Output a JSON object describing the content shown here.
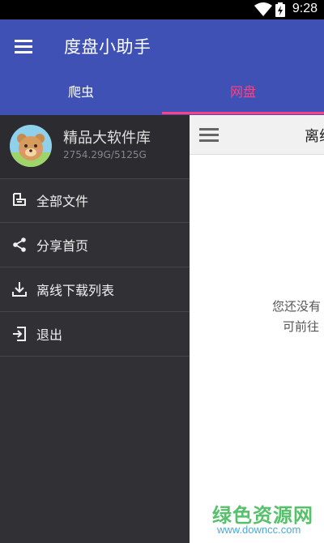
{
  "status_bar": {
    "time": "9:28",
    "icons": [
      "wifi-icon",
      "battery-charging-icon"
    ]
  },
  "app_bar": {
    "title": "度盘小助手",
    "menu_icon": "hamburger-menu-icon",
    "color": "#3f51b5"
  },
  "tabs": [
    {
      "label": "爬虫",
      "selected": false
    },
    {
      "label": "网盘",
      "selected": true
    }
  ],
  "accent_color": "#ff4081",
  "drawer": {
    "profile": {
      "name": "精品大软件库",
      "quota": "2754.29G/5125G",
      "avatar_icon": "bear-avatar"
    },
    "items": [
      {
        "label": "全部文件",
        "icon": "printer-icon"
      },
      {
        "label": "分享首页",
        "icon": "share-icon"
      },
      {
        "label": "离线下载列表",
        "icon": "download-icon"
      },
      {
        "label": "退出",
        "icon": "logout-icon"
      }
    ]
  },
  "content": {
    "toolbar_title": "离线",
    "empty_line1": "您还没有",
    "empty_line2": "可前往"
  },
  "watermark": {
    "title": "绿色资源网",
    "url": "www.downcc.com"
  }
}
